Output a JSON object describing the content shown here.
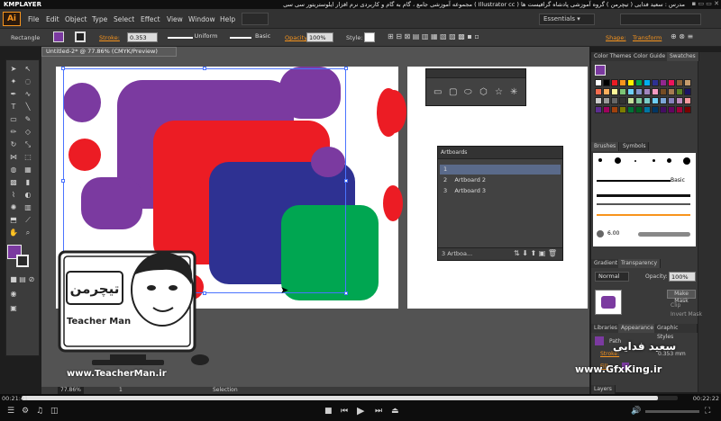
{
  "player": {
    "logo": "KMPLAYER",
    "title": "مجموعه آموزشی جامع ، گام به گام و کاربردی نرم افزار ایلوستریتور سی سی ( Illustrator cc ) مدرس : سعید فدایی ( تیچرمن ) گروه آموزشی پادشاه گرافیست ها",
    "win_buttons": "▪ ▭ ▭ ✕",
    "time_elapsed": "00:21:41",
    "time_total": "00:22:22",
    "progress": 0.97
  },
  "app": {
    "logo": "Ai",
    "menus": [
      "File",
      "Edit",
      "Object",
      "Type",
      "Select",
      "Effect",
      "View",
      "Window",
      "Help"
    ],
    "workspace": "Essentials",
    "workspace_arrow": "▾"
  },
  "control": {
    "tool": "Rectangle",
    "stroke_label": "Stroke:",
    "stroke_value": "0.353 mm",
    "profile": "Uniform",
    "brush": "Basic",
    "opacity_label": "Opacity:",
    "opacity_value": "100%",
    "style_label": "Style:",
    "shape_label": "Shape:",
    "transform_label": "Transform"
  },
  "document": {
    "tab": "Untitled-2* @ 77.86% (CMYK/Preview)",
    "zoom": "77.86%",
    "page": "1",
    "status_tool": "Selection"
  },
  "artboards_panel": {
    "title": "Artboards",
    "rows": [
      {
        "num": "1",
        "name": ""
      },
      {
        "num": "2",
        "name": "Artboard 2"
      },
      {
        "num": "3",
        "name": "Artboard 3"
      }
    ],
    "footer": "3 Artboa..."
  },
  "right_panels": {
    "swatch_tabs": [
      "Color Themes",
      "Color Guide",
      "Swatches"
    ],
    "brush_tabs": [
      "Brushes",
      "Symbols"
    ],
    "brush_basic": "Basic",
    "brush_size": "6.00",
    "transparency_tabs": [
      "Gradient",
      "Transparency"
    ],
    "blend_mode": "Normal",
    "opacity_label": "Opacity:",
    "opacity_value": "100%",
    "make_mask": "Make Mask",
    "clip": "Clip",
    "invert_mask": "Invert Mask",
    "appearance_tabs": [
      "Libraries",
      "Appearance",
      "Graphic Styles"
    ],
    "path_label": "Path",
    "stroke_label": "Stroke:",
    "stroke_value": "0.353 mm",
    "fill_label": "Fill:",
    "layers_tab": "Layers"
  },
  "watermarks": {
    "teacher_url": "www.TeacherMan.ir",
    "teacher_name": "Teacher Man",
    "teacher_logo": "تیچرمن",
    "gfx_url": "www.GfxKing.ir",
    "signature": "سعید فدایی"
  },
  "colors": {
    "purple": "#7b3aa0",
    "red": "#ec1c24",
    "blue": "#2e3192",
    "green": "#00a651",
    "accent": "#f7941d"
  }
}
